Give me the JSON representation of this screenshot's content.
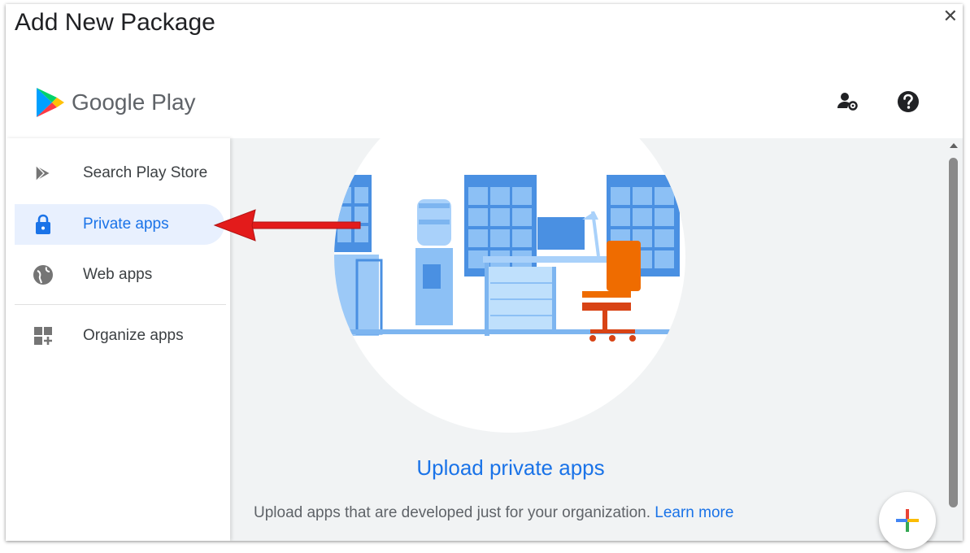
{
  "dialog": {
    "title": "Add New Package",
    "close_label": "✕"
  },
  "header": {
    "logo_text": "Google Play",
    "admin_icon": "admin-settings-icon",
    "help_icon": "help-icon"
  },
  "sidebar": {
    "items": [
      {
        "label": "Search Play Store",
        "icon": "play-store-icon",
        "active": false
      },
      {
        "label": "Private apps",
        "icon": "lock-icon",
        "active": true
      },
      {
        "label": "Web apps",
        "icon": "globe-icon",
        "active": false
      },
      {
        "label": "Organize apps",
        "icon": "organize-icon",
        "active": false
      }
    ]
  },
  "main": {
    "title": "Upload private apps",
    "description": "Upload apps that are developed just for your organization.",
    "learn_more": "Learn more"
  },
  "colors": {
    "accent": "#1a73e8",
    "active_bg": "#e8f0fe",
    "arrow": "#e31b1b",
    "chair": "#ef6c00"
  }
}
